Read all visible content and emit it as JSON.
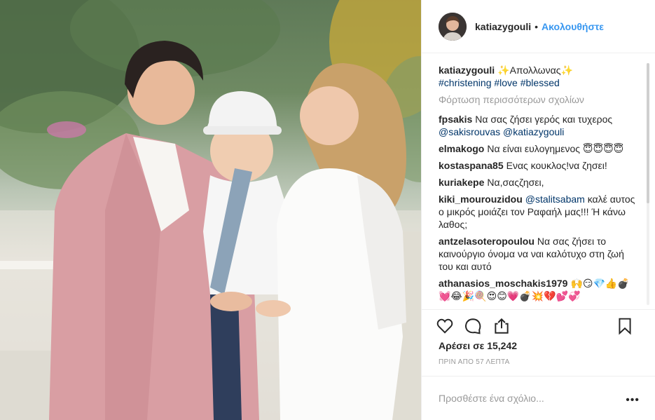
{
  "post": {
    "author": "katiazygouli",
    "follow_dot": "•",
    "follow_label": "Ακολουθήστε",
    "caption": {
      "user": "katiazygouli",
      "text": "✨Απολλωνας✨",
      "hashtags": "#christening #love #blessed"
    },
    "load_more": "Φόρτωση περισσότερων σχολίων",
    "comments": [
      {
        "user": "fpsakis",
        "text": "Να σας ζήσει γερός και τυχερος",
        "mentions": "@sakisrouvas @katiazygouli"
      },
      {
        "user": "elmakogo",
        "text": "Να είναι ευλογημενος 😇😇😇😇"
      },
      {
        "user": "kostaspana85",
        "text": "Ενας κουκλος!να ζησει!"
      },
      {
        "user": "kuriakepe",
        "text": "Να,σαςζησει,"
      },
      {
        "user": "kiki_mourouzidou",
        "mention": "@stalitsabam",
        "text": "καλέ αυτος ο μικρός μοιάζει τον Ραφαήλ μας!!! Ή κάνω λαθος;"
      },
      {
        "user": "antzelasoteropoulou",
        "text": "Να σας ζήσει το καινούργιο όνομα να ναι καλότυχο στη ζωή του και αυτό"
      },
      {
        "user": "athanasios_moschakis1979",
        "text": "🙌😏💎👍💣💓😂🎉🍭😍😊💗💣💥💔💕💞"
      }
    ],
    "likes": "Αρέσει σε 15,242",
    "time_ago": "ΠΡΙΝ ΑΠΟ 57 ΛΕΠΤΑ",
    "add_comment_placeholder": "Προσθέστε ένα σχόλιο...",
    "more_options": "•••"
  },
  "icons": {
    "like": "heart-icon",
    "comment": "comment-icon",
    "share": "share-icon",
    "save": "bookmark-icon"
  },
  "colors": {
    "accent": "#3897f0",
    "link": "#003569",
    "muted": "#999999",
    "border": "#efefef"
  }
}
